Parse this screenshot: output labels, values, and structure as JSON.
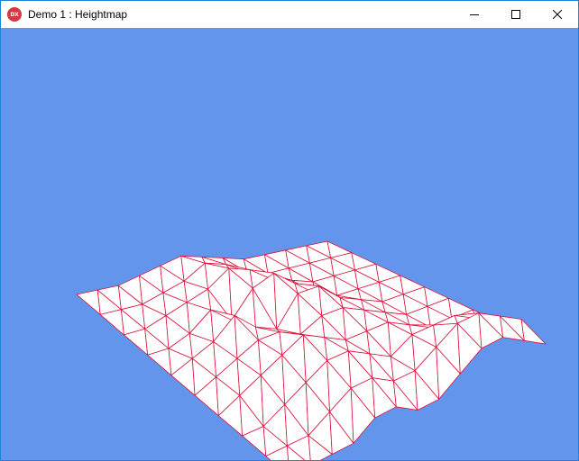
{
  "window": {
    "title": "Demo 1 : Heightmap",
    "icon_name": "directx-icon",
    "icon_text": "DX",
    "controls": [
      "minimize",
      "maximize",
      "close"
    ]
  },
  "scene": {
    "background_color": "#6495ed",
    "mesh_fill_color": "#ffffff",
    "wire_color": "#dc143c",
    "grid_columns": 12,
    "grid_rows": 9,
    "heightmap": [
      [
        0,
        0,
        0,
        1,
        2,
        3,
        2,
        1,
        0,
        0,
        0,
        0,
        0
      ],
      [
        0,
        0,
        0,
        1,
        2,
        4,
        3,
        1,
        0,
        0,
        0,
        0,
        0
      ],
      [
        0,
        0,
        1,
        2,
        3,
        5,
        4,
        2,
        1,
        0,
        0,
        0,
        0
      ],
      [
        0,
        0,
        1,
        3,
        1,
        4,
        5,
        3,
        1,
        0,
        0,
        0,
        0
      ],
      [
        0,
        1,
        2,
        4,
        2,
        1,
        4,
        4,
        2,
        1,
        0,
        0,
        0
      ],
      [
        0,
        1,
        2,
        3,
        3,
        2,
        3,
        3,
        2,
        1,
        0,
        0,
        0
      ],
      [
        0,
        1,
        2,
        3,
        4,
        3,
        2,
        2,
        2,
        1,
        0,
        0,
        0
      ],
      [
        0,
        0,
        1,
        2,
        3,
        3,
        2,
        1,
        2,
        2,
        2,
        1,
        0
      ],
      [
        0,
        0,
        0,
        1,
        2,
        2,
        1,
        1,
        2,
        3,
        3,
        2,
        1
      ],
      [
        0,
        0,
        0,
        0,
        1,
        1,
        0,
        0,
        1,
        2,
        2,
        1,
        0
      ]
    ]
  }
}
